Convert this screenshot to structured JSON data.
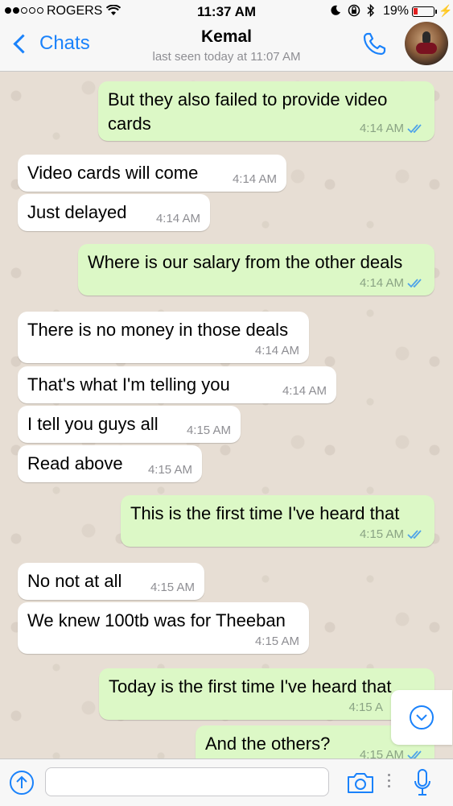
{
  "status_bar": {
    "carrier": "ROGERS",
    "time": "11:37 AM",
    "battery": "19%",
    "icons": [
      "signal-dots",
      "wifi-icon",
      "moon-icon",
      "rotation-lock-icon",
      "bluetooth-icon",
      "battery-icon",
      "charging-icon"
    ]
  },
  "header": {
    "back_label": "Chats",
    "contact_name": "Kemal",
    "last_seen": "last seen today at 11:07 AM",
    "icons": [
      "chevron-left-icon",
      "phone-icon",
      "avatar"
    ]
  },
  "messages": [
    {
      "dir": "out",
      "text": "But they also failed to provide video cards",
      "time": "4:14 AM",
      "read": true
    },
    {
      "dir": "in",
      "text": "Video cards will come",
      "time": "4:14 AM"
    },
    {
      "dir": "in",
      "text": "Just delayed",
      "time": "4:14 AM"
    },
    {
      "dir": "out",
      "text": "Where is our salary from the other deals",
      "time": "4:14 AM",
      "read": true
    },
    {
      "dir": "in",
      "text": "There is no money in those deals",
      "time": "4:14 AM"
    },
    {
      "dir": "in",
      "text": "That's what I'm telling you",
      "time": "4:14 AM"
    },
    {
      "dir": "in",
      "text": "I tell you guys all",
      "time": "4:15 AM"
    },
    {
      "dir": "in",
      "text": "Read above",
      "time": "4:15 AM"
    },
    {
      "dir": "out",
      "text": "This is the first time I've heard that",
      "time": "4:15 AM",
      "read": true
    },
    {
      "dir": "in",
      "text": "No not at all",
      "time": "4:15 AM"
    },
    {
      "dir": "in",
      "text": "We knew 100tb was for Theeban",
      "time": "4:15 AM"
    },
    {
      "dir": "out",
      "text": "Today is the first time I've heard that",
      "time": "4:15 A",
      "read": false
    },
    {
      "dir": "out",
      "text": "And the others?",
      "time": "4:15 AM",
      "read": true
    }
  ],
  "input_bar": {
    "icons": [
      "upload-icon",
      "camera-icon",
      "microphone-icon"
    ],
    "placeholder": ""
  },
  "scroll_down": {
    "icon": "chevron-down-circle-icon"
  },
  "colors": {
    "accent": "#1a82fb",
    "outgoing_bubble": "#dcf8c6",
    "incoming_bubble": "#ffffff",
    "chat_background": "#e5ddd5",
    "read_ticks": "#4fa3e8"
  }
}
